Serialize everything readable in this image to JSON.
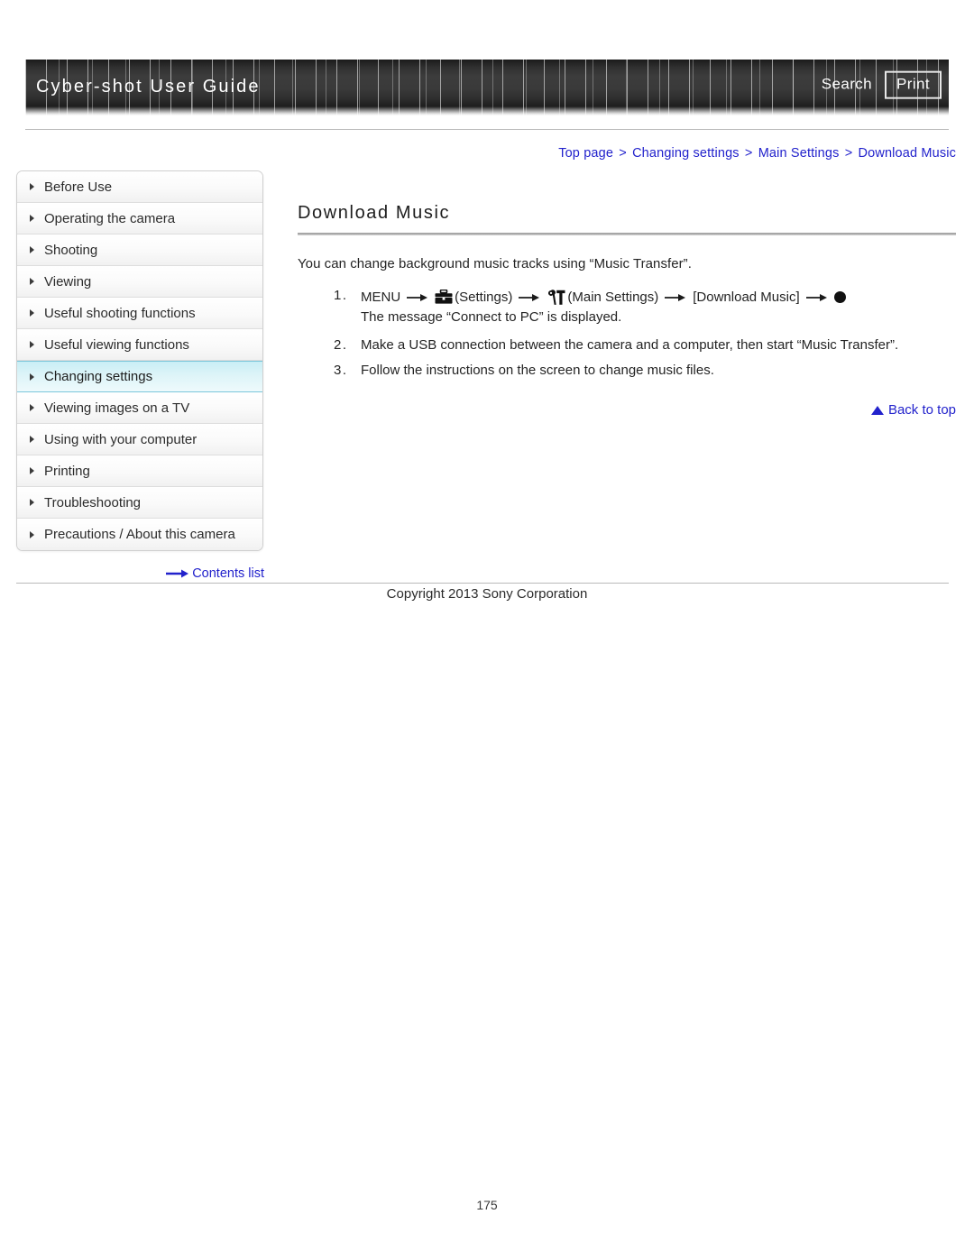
{
  "header": {
    "title": "Cyber-shot User Guide",
    "search_label": "Search",
    "print_label": "Print"
  },
  "breadcrumb": {
    "separator": ">",
    "items": [
      {
        "label": "Top page"
      },
      {
        "label": "Changing settings"
      },
      {
        "label": "Main Settings"
      },
      {
        "label": "Download Music"
      }
    ]
  },
  "sidebar": {
    "items": [
      {
        "label": "Before Use",
        "active": false
      },
      {
        "label": "Operating the camera",
        "active": false
      },
      {
        "label": "Shooting",
        "active": false
      },
      {
        "label": "Viewing",
        "active": false
      },
      {
        "label": "Useful shooting functions",
        "active": false
      },
      {
        "label": "Useful viewing functions",
        "active": false
      },
      {
        "label": "Changing settings",
        "active": true
      },
      {
        "label": "Viewing images on a TV",
        "active": false
      },
      {
        "label": "Using with your computer",
        "active": false
      },
      {
        "label": "Printing",
        "active": false
      },
      {
        "label": "Troubleshooting",
        "active": false
      },
      {
        "label": "Precautions / About this camera",
        "active": false
      }
    ],
    "contents_link": "Contents list"
  },
  "main": {
    "title": "Download Music",
    "intro": "You can change background music tracks using “Music Transfer”.",
    "steps": [
      {
        "number": "1.",
        "parts": {
          "menu": "MENU",
          "settings_label": "(Settings)",
          "main_settings_label": "(Main Settings)",
          "download_music_label": "[Download Music]"
        },
        "sub": "The message “Connect to PC” is displayed."
      },
      {
        "number": "2.",
        "text": "Make a USB connection between the camera and a computer, then start “Music Transfer”."
      },
      {
        "number": "3.",
        "text": "Follow the instructions on the screen to change music files."
      }
    ],
    "back_to_top": "Back to top"
  },
  "footer": {
    "copyright": "Copyright 2013 Sony Corporation",
    "page_number": "175"
  },
  "colors": {
    "link_blue": "#2222CC",
    "active_nav_cyan": "#C9EEF5",
    "header_dark": "#333333"
  }
}
